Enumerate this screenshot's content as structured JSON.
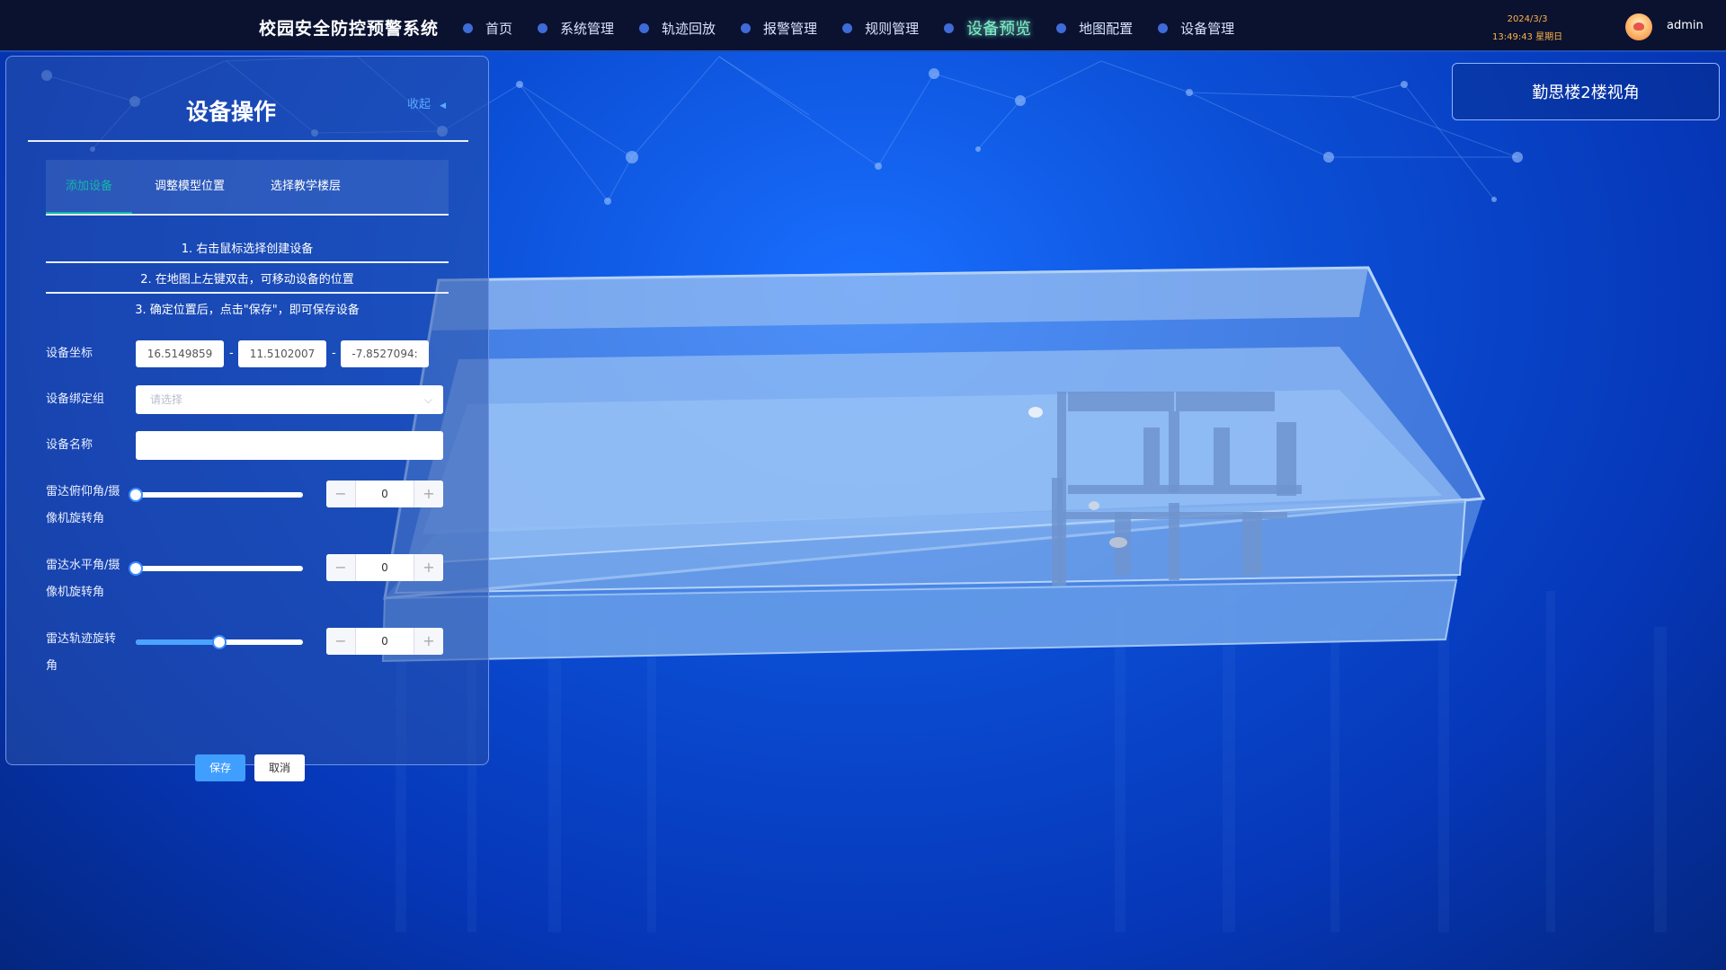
{
  "header": {
    "app_title": "校园安全防控预警系统",
    "nav": [
      {
        "label": "首页",
        "active": false
      },
      {
        "label": "系统管理",
        "active": false
      },
      {
        "label": "轨迹回放",
        "active": false
      },
      {
        "label": "报警管理",
        "active": false
      },
      {
        "label": "规则管理",
        "active": false
      },
      {
        "label": "设备预览",
        "active": true
      },
      {
        "label": "地图配置",
        "active": false
      },
      {
        "label": "设备管理",
        "active": false
      }
    ],
    "date": "2024/3/3",
    "time_weekday": "13:49:43 星期日",
    "username": "admin"
  },
  "view_badge": "勤思楼2楼视角",
  "panel": {
    "title": "设备操作",
    "collapse_label": "收起",
    "tabs": [
      {
        "label": "添加设备",
        "active": true
      },
      {
        "label": "调整模型位置",
        "active": false
      },
      {
        "label": "选择教学楼层",
        "active": false
      }
    ],
    "steps": [
      "1. 右击鼠标选择创建设备",
      "2. 在地图上左键双击，可移动设备的位置",
      "3. 确定位置后，点击\"保存\"，即可保存设备"
    ],
    "coord_label": "设备坐标",
    "coord_x": "16.5149859",
    "coord_y": "11.5102007",
    "coord_z": "-7.8527094:",
    "coord_sep": "-",
    "group_label": "设备绑定组",
    "group_placeholder": "请选择",
    "name_label": "设备名称",
    "name_value": "",
    "pitch_label_1": "雷达俯仰角/摄",
    "pitch_label_2": "像机旋转角",
    "pitch_value": "0",
    "pitch_fraction": 0.0,
    "horizontal_label_1": "雷达水平角/摄",
    "horizontal_label_2": "像机旋转角",
    "horizontal_value": "0",
    "horizontal_fraction": 0.0,
    "track_label_1": "雷达轨迹旋转",
    "track_label_2": "角",
    "track_value": "0",
    "track_fraction": 0.5,
    "save_label": "保存",
    "cancel_label": "取消"
  },
  "icons": {
    "collapse": "caret-left-icon",
    "select": "chevron-down-icon",
    "minus": "minus-icon",
    "plus": "plus-icon"
  },
  "colors": {
    "header_bg": "#0a1230",
    "accent": "#409eff",
    "active_nav": "#7ef0c9",
    "active_tab": "#12b8a6",
    "datetime": "#ffb347"
  }
}
